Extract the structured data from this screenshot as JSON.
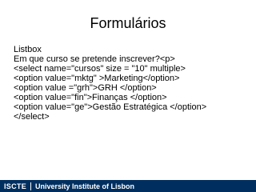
{
  "slide": {
    "title": "Formulários",
    "body_lines": [
      "Listbox",
      "Em que curso se pretende inscrever?<p>",
      "<select name=\"cursos\" size = \"10\" multiple>",
      "<option value=\"mktg\" >Marketing</option>",
      "<option value =\"grh\">GRH </option>",
      "<option value=\"fin\">Finanças </option>",
      "<option value=\"ge\">Gestão Estratégica </option>",
      "</select>"
    ]
  },
  "footer": {
    "logo_text": "ISCTE",
    "institution": "University Institute of Lisbon",
    "background_color": "#002f5f"
  }
}
